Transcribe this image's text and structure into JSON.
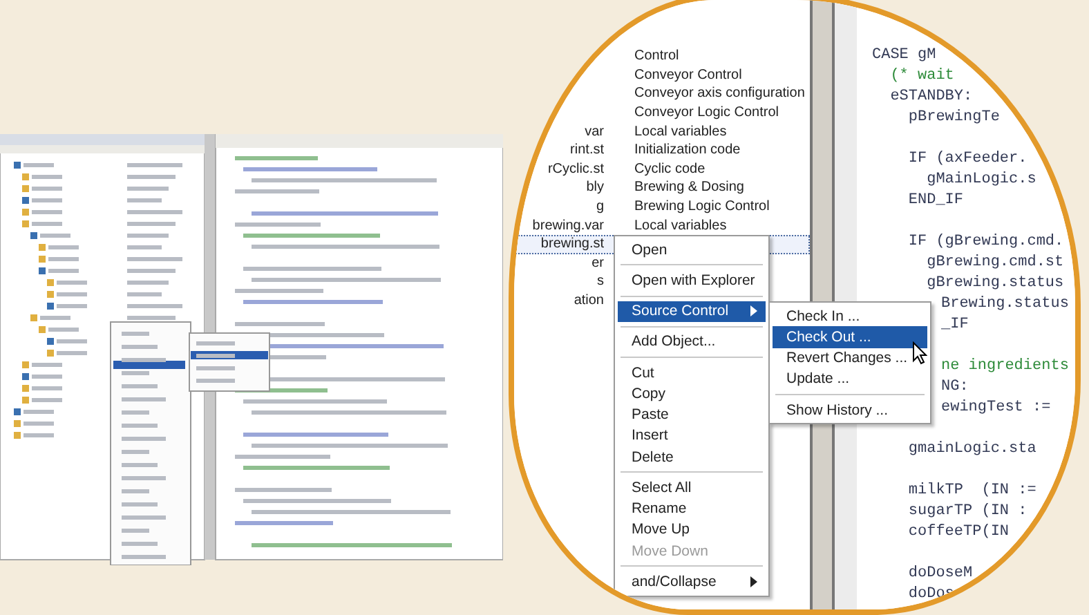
{
  "tree": {
    "rows": [
      {
        "name": "",
        "description": "Control",
        "selected": false
      },
      {
        "name": "",
        "description": "Conveyor Control",
        "selected": false
      },
      {
        "name": "",
        "description": "Conveyor axis configuration",
        "selected": false
      },
      {
        "name": "",
        "description": "Conveyor Logic Control",
        "selected": false
      },
      {
        "name": "var",
        "description": "Local variables",
        "selected": false
      },
      {
        "name": "rint.st",
        "description": "Initialization code",
        "selected": false
      },
      {
        "name": "rCyclic.st",
        "description": "Cyclic code",
        "selected": false
      },
      {
        "name": "bly",
        "description": "Brewing & Dosing",
        "selected": false
      },
      {
        "name": "g",
        "description": "Brewing Logic Control",
        "selected": false
      },
      {
        "name": "brewing.var",
        "description": "Local variables",
        "selected": false
      },
      {
        "name": "brewing.st",
        "description": "",
        "selected": true
      },
      {
        "name": "er",
        "description": "",
        "selected": false
      },
      {
        "name": "s",
        "description": "",
        "selected": false
      },
      {
        "name": "ation",
        "description": "",
        "selected": false
      }
    ]
  },
  "context_menu": {
    "items": [
      {
        "kind": "item",
        "label": "Open",
        "selected": false,
        "disabled": false,
        "has_submenu": false
      },
      {
        "kind": "separator"
      },
      {
        "kind": "item",
        "label": "Open with Explorer",
        "selected": false,
        "disabled": false,
        "has_submenu": false
      },
      {
        "kind": "separator"
      },
      {
        "kind": "item",
        "label": "Source Control",
        "selected": true,
        "disabled": false,
        "has_submenu": true
      },
      {
        "kind": "separator"
      },
      {
        "kind": "item",
        "label": "Add Object...",
        "selected": false,
        "disabled": false,
        "has_submenu": false
      },
      {
        "kind": "separator"
      },
      {
        "kind": "item",
        "label": "Cut",
        "selected": false,
        "disabled": false,
        "has_submenu": false
      },
      {
        "kind": "item",
        "label": "Copy",
        "selected": false,
        "disabled": false,
        "has_submenu": false
      },
      {
        "kind": "item",
        "label": "Paste",
        "selected": false,
        "disabled": false,
        "has_submenu": false
      },
      {
        "kind": "item",
        "label": "Insert",
        "selected": false,
        "disabled": false,
        "has_submenu": false
      },
      {
        "kind": "item",
        "label": "Delete",
        "selected": false,
        "disabled": false,
        "has_submenu": false
      },
      {
        "kind": "separator"
      },
      {
        "kind": "item",
        "label": "Select All",
        "selected": false,
        "disabled": false,
        "has_submenu": false
      },
      {
        "kind": "item",
        "label": "Rename",
        "selected": false,
        "disabled": false,
        "has_submenu": false
      },
      {
        "kind": "item",
        "label": "Move Up",
        "selected": false,
        "disabled": false,
        "has_submenu": false
      },
      {
        "kind": "item",
        "label": "Move Down",
        "selected": false,
        "disabled": true,
        "has_submenu": false
      },
      {
        "kind": "separator"
      },
      {
        "kind": "item",
        "label": "and/Collapse",
        "selected": false,
        "disabled": false,
        "has_submenu": true
      }
    ]
  },
  "submenu": {
    "items": [
      {
        "kind": "item",
        "label": "Check In ...",
        "selected": false
      },
      {
        "kind": "item",
        "label": "Check Out ...",
        "selected": true
      },
      {
        "kind": "item",
        "label": "Revert Changes ...",
        "selected": false
      },
      {
        "kind": "item",
        "label": "Update ...",
        "selected": false
      },
      {
        "kind": "separator"
      },
      {
        "kind": "item",
        "label": "Show History ...",
        "selected": false
      }
    ]
  },
  "code": {
    "lines": [
      {
        "kind": "code",
        "text": "CASE gM"
      },
      {
        "kind": "comment",
        "text": "  (* wait"
      },
      {
        "kind": "code",
        "text": "  eSTANDBY:"
      },
      {
        "kind": "code",
        "text": "    pBrewingTe"
      },
      {
        "kind": "blank"
      },
      {
        "kind": "code",
        "text": "    IF (axFeeder."
      },
      {
        "kind": "code",
        "text": "      gMainLogic.s"
      },
      {
        "kind": "code",
        "text": "    END_IF"
      },
      {
        "kind": "blank"
      },
      {
        "kind": "code",
        "text": "    IF (gBrewing.cmd."
      },
      {
        "kind": "code",
        "text": "      gBrewing.cmd.st"
      },
      {
        "kind": "code",
        "text": "      gBrewing.status"
      },
      {
        "kind": "covered-code",
        "text": "Brewing.status"
      },
      {
        "kind": "covered-code",
        "text": "_IF"
      },
      {
        "kind": "blank"
      },
      {
        "kind": "covered-comment",
        "text": "ne ingredients"
      },
      {
        "kind": "covered-code",
        "text": "NG:"
      },
      {
        "kind": "covered-code",
        "text": "ewingTest :="
      },
      {
        "kind": "blank"
      },
      {
        "kind": "code",
        "text": "    gmainLogic.sta"
      },
      {
        "kind": "blank"
      },
      {
        "kind": "code",
        "text": "    milkTP  (IN :="
      },
      {
        "kind": "code",
        "text": "    sugarTP (IN :"
      },
      {
        "kind": "code",
        "text": "    coffeeTP(IN"
      },
      {
        "kind": "blank"
      },
      {
        "kind": "code",
        "text": "    doDoseM"
      },
      {
        "kind": "code",
        "text": "    doDos"
      }
    ]
  }
}
